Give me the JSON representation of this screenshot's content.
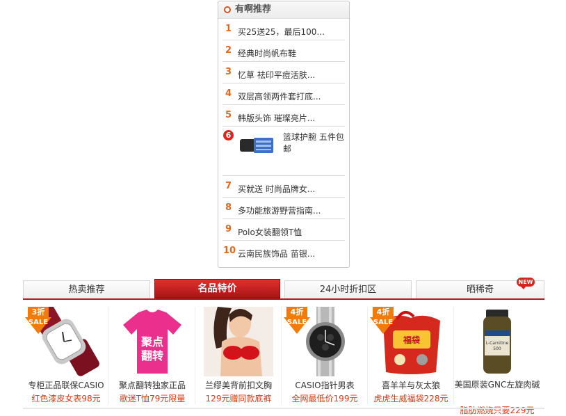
{
  "recommend": {
    "title": "有啊推荐",
    "items": [
      {
        "num": "1",
        "text": "买25送25，最后100..."
      },
      {
        "num": "2",
        "text": "经典时尚帆布鞋"
      },
      {
        "num": "3",
        "text": "忆草  祛印平痘活肤..."
      },
      {
        "num": "4",
        "text": "双层高领两件套打底..."
      },
      {
        "num": "5",
        "text": "韩版头饰  璀璨亮片..."
      },
      {
        "num": "6",
        "text": "篮球护腕  五件包邮"
      },
      {
        "num": "7",
        "text": "买就送  时尚品牌女..."
      },
      {
        "num": "8",
        "text": "多功能旅游野营指南..."
      },
      {
        "num": "9",
        "text": "Polo女装翻领T恤"
      },
      {
        "num": "10",
        "text": "云南民族饰品  苗银..."
      }
    ]
  },
  "tabs": [
    {
      "label": "热卖推荐",
      "active": false
    },
    {
      "label": "名品特价",
      "active": true
    },
    {
      "label": "24小时折扣区",
      "active": false
    },
    {
      "label": "晒稀奇",
      "active": false,
      "badge": "NEW"
    }
  ],
  "products": [
    {
      "name": "专柜正品联保CASIO",
      "price": "红色漆皮女表98元",
      "discount": "3折",
      "sale": "SALE"
    },
    {
      "name": "聚点翻转独家正品",
      "price": "歌迷T恤79元限量"
    },
    {
      "name": "兰缪美背前扣文胸",
      "price": "129元赠同款底裤"
    },
    {
      "name": "CASIO指针男表",
      "price": "全网最低价199元",
      "discount": "4折",
      "sale": "SALE"
    },
    {
      "name": "喜羊羊与灰太狼",
      "price": "虎虎生威福袋228元",
      "discount": "4折",
      "sale": "SALE"
    },
    {
      "name": "美国原装GNC左旋肉碱",
      "price": "脂肪燃烧只要229元"
    }
  ],
  "colors": {
    "accent": "#b81818",
    "rank": "#e4671b",
    "price": "#d83a12",
    "sale": "#f07c0c"
  }
}
